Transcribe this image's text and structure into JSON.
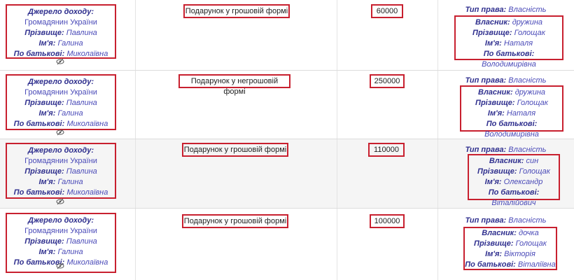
{
  "labels": {
    "source": "Джерело доходу:",
    "surname": "Прізвище:",
    "name": "Ім'я:",
    "patronymic": "По батькові:",
    "right_type": "Тип права:",
    "owner": "Власник:"
  },
  "rows": [
    {
      "source": {
        "value": "Громадянин України",
        "surname": "Павлина",
        "name": "Галина",
        "patronymic": "Миколаївна"
      },
      "type": "Подарунок у грошовій формі",
      "amount": "60000",
      "rights": {
        "right_type": "Власність",
        "owner": "дружина",
        "surname": "Голощак",
        "name": "Наталя",
        "patronymic": "Володимирівна"
      }
    },
    {
      "source": {
        "value": "Громадянин України",
        "surname": "Павлина",
        "name": "Галина",
        "patronymic": "Миколаївна"
      },
      "type": "Подарунок у негрошовій формі",
      "amount": "250000",
      "rights": {
        "right_type": "Власність",
        "owner": "дружина",
        "surname": "Голощак",
        "name": "Наталя",
        "patronymic": "Володимирівна"
      }
    },
    {
      "source": {
        "value": "Громадянин України",
        "surname": "Павлина",
        "name": "Галина",
        "patronymic": "Миколаївна"
      },
      "type": "Подарунок у грошовій формі",
      "amount": "110000",
      "rights": {
        "right_type": "Власність",
        "owner": "син",
        "surname": "Голощак",
        "name": "Олександр",
        "patronymic": "Віталійович"
      }
    },
    {
      "source": {
        "value": "Громадянин України",
        "surname": "Павлина",
        "name": "Галина",
        "patronymic": "Миколаївна"
      },
      "type": "Подарунок у грошовій формі",
      "amount": "100000",
      "rights": {
        "right_type": "Власність",
        "owner": "дочка",
        "surname": "Голощак",
        "name": "Вікторія",
        "patronymic": "Віталіївна"
      }
    }
  ]
}
